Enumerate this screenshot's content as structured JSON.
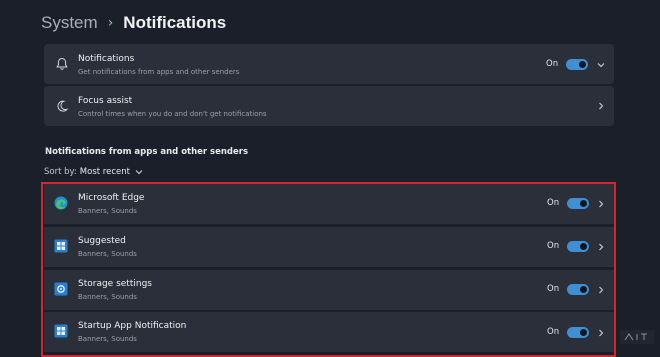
{
  "breadcrumb": {
    "parent": "System",
    "separator": "›",
    "current": "Notifications"
  },
  "top_settings": [
    {
      "title": "Notifications",
      "subtitle": "Get notifications from apps and other senders",
      "state": "On",
      "toggle_on": true,
      "chevron": "chevron-down-icon",
      "icon": "bell-icon"
    },
    {
      "title": "Focus assist",
      "subtitle": "Control times when you do and don't get notifications",
      "chevron": "chevron-right-icon",
      "icon": "moon-icon"
    }
  ],
  "section_title": "Notifications from apps and other senders",
  "sort": {
    "label": "Sort by:",
    "value": "Most recent"
  },
  "apps": [
    {
      "name": "Microsoft Edge",
      "subtitle": "Banners, Sounds",
      "state": "On",
      "toggle_on": true,
      "icon": "edge-icon"
    },
    {
      "name": "Suggested",
      "subtitle": "Banners, Sounds",
      "state": "On",
      "toggle_on": true,
      "icon": "windows-app-icon"
    },
    {
      "name": "Storage settings",
      "subtitle": "Banners, Sounds",
      "state": "On",
      "toggle_on": true,
      "icon": "gear-app-icon"
    },
    {
      "name": "Startup App Notification",
      "subtitle": "Banners, Sounds",
      "state": "On",
      "toggle_on": true,
      "icon": "windows-app-icon"
    }
  ],
  "colors": {
    "background": "#1b1f2a",
    "card": "#2a2f3a",
    "accent": "#3f8fd2",
    "highlight": "#d4262e"
  }
}
